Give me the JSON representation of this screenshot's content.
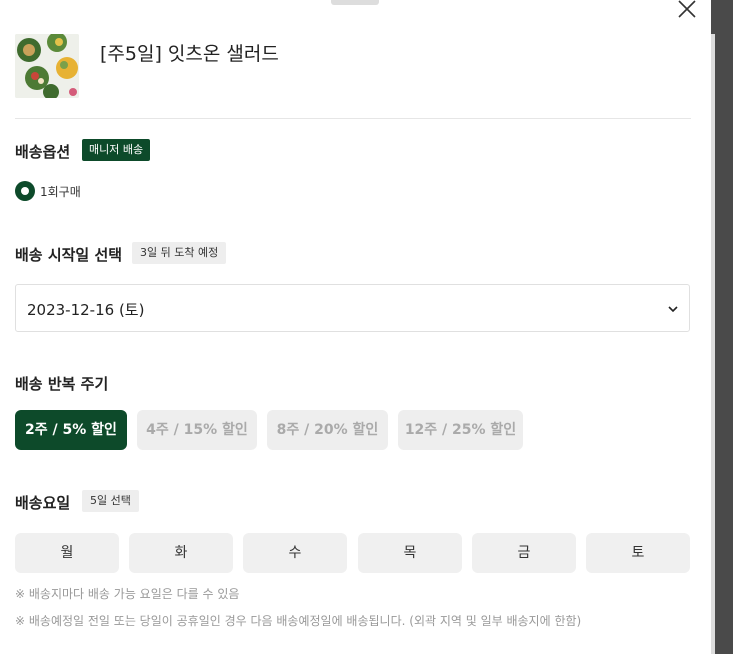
{
  "product": {
    "title": "[주5일] 잇츠온 샐러드"
  },
  "delivery_option": {
    "label": "배송옵션",
    "badge": "매니저 배송",
    "radio_label": "1회구매"
  },
  "start_date": {
    "label": "배송 시작일 선택",
    "badge": "3일 뒤 도착 예정",
    "selected": "2023-12-16 (토)"
  },
  "cycle": {
    "label": "배송 반복 주기",
    "options": [
      {
        "label": "2주 / 5% 할인",
        "selected": true
      },
      {
        "label": "4주 / 15% 할인",
        "selected": false
      },
      {
        "label": "8주 / 20% 할인",
        "selected": false
      },
      {
        "label": "12주 / 25% 할인",
        "selected": false
      }
    ]
  },
  "days": {
    "label": "배송요일",
    "badge": "5일 선택",
    "items": [
      "월",
      "화",
      "수",
      "목",
      "금",
      "토"
    ]
  },
  "notes": [
    "※ 배송지마다 배송 가능 요일은 다를 수 있음",
    "※ 배송예정일 전일 또는 당일이 공휴일인 경우 다음 배송예정일에 배송됩니다. (외곽 지역 및 일부 배송지에 한함)"
  ],
  "colors": {
    "accent": "#0d4a2a",
    "muted_button": "#eeeeee",
    "day_button": "#f0f0f0"
  },
  "icons": {
    "close": "close-icon",
    "chevron": "chevron-down-icon"
  }
}
